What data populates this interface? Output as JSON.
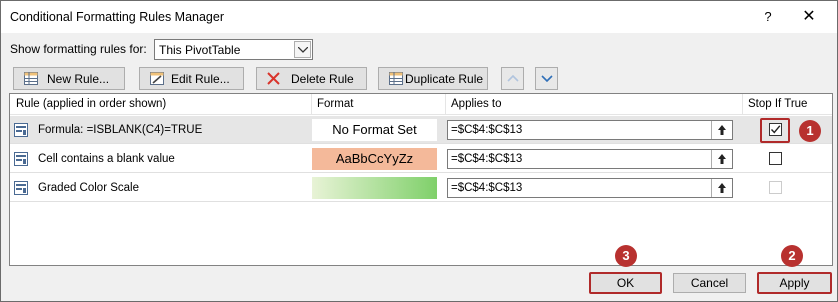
{
  "window": {
    "title": "Conditional Formatting Rules Manager",
    "help": "?",
    "close": "✕"
  },
  "show": {
    "label": "Show formatting rules for:",
    "selected": "This PivotTable"
  },
  "toolbar": {
    "new_rule": "New Rule...",
    "edit_rule": "Edit Rule...",
    "delete_rule": "Delete Rule",
    "duplicate_rule": "Duplicate Rule"
  },
  "columns": {
    "rule": "Rule (applied in order shown)",
    "format": "Format",
    "applies_to": "Applies to",
    "stop_if_true": "Stop If True"
  },
  "rules": [
    {
      "rule": "Formula: =ISBLANK(C4)=TRUE",
      "format": "No Format Set",
      "applies_to": "=$C$4:$C$13",
      "stop_if_true": true,
      "selected": true
    },
    {
      "rule": "Cell contains a blank value",
      "format": "AaBbCcYyZz",
      "applies_to": "=$C$4:$C$13",
      "stop_if_true": false
    },
    {
      "rule": "Graded Color Scale",
      "format": "",
      "applies_to": "=$C$4:$C$13",
      "stop_if_true": false,
      "disabled": true
    }
  ],
  "buttons": {
    "ok": "OK",
    "cancel": "Cancel",
    "apply": "Apply"
  },
  "badges": {
    "b1": "1",
    "b2": "2",
    "b3": "3"
  },
  "colors": {
    "highlight": "#b02a2a",
    "blank_fill": "#f4b99a",
    "scale_from": "#e8f3d6",
    "scale_to": "#7fd06a"
  }
}
